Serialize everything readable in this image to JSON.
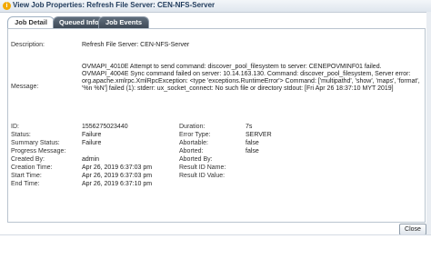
{
  "window": {
    "title": "View Job Properties: Refresh File Server: CEN-NFS-Server"
  },
  "tabs": [
    {
      "label": "Job Detail",
      "active": true
    },
    {
      "label": "Queued Info",
      "active": false
    },
    {
      "label": "Job Events",
      "active": false
    }
  ],
  "details": {
    "description_label": "Description:",
    "description_value": "Refresh File Server: CEN-NFS-Server",
    "message_label": "Message:",
    "message_value": "OVMAPI_4010E Attempt to send command: discover_pool_filesystem to server: CENEPOVMINF01 failed. OVMAPI_4004E Sync command failed on server: 10.14.163.130. Command: discover_pool_filesystem, Server error: org.apache.xmlrpc.XmlRpcException: <type 'exceptions.RuntimeError'> Command: ['multipathd', 'show', 'maps', 'format', '%n %N'] failed (1): stderr: ux_socket_connect: No such file or directory stdout: [Fri Apr 26 18:37:10 MYT 2019]",
    "left": [
      {
        "label": "ID:",
        "value": "1556275023440"
      },
      {
        "label": "Status:",
        "value": "Failure"
      },
      {
        "label": "Summary Status:",
        "value": "Failure"
      },
      {
        "label": "Progress Message:",
        "value": ""
      },
      {
        "label": "Created By:",
        "value": "admin"
      },
      {
        "label": "Creation Time:",
        "value": "Apr 26, 2019 6:37:03 pm"
      },
      {
        "label": "Start Time:",
        "value": "Apr 26, 2019 6:37:03 pm"
      },
      {
        "label": "End Time:",
        "value": "Apr 26, 2019 6:37:10 pm"
      }
    ],
    "right": [
      {
        "label": "Duration:",
        "value": "7s"
      },
      {
        "label": "Error Type:",
        "value": "SERVER"
      },
      {
        "label": "Abortable:",
        "value": "false"
      },
      {
        "label": "Aborted:",
        "value": "false"
      },
      {
        "label": "Aborted By:",
        "value": ""
      },
      {
        "label": "Result ID Name:",
        "value": ""
      },
      {
        "label": "Result ID Value:",
        "value": ""
      }
    ]
  },
  "buttons": {
    "close": "Close"
  },
  "colors": {
    "tab_inactive": "#4a5663",
    "title_text": "#1f3a5b",
    "accent_icon": "#f2a900"
  }
}
